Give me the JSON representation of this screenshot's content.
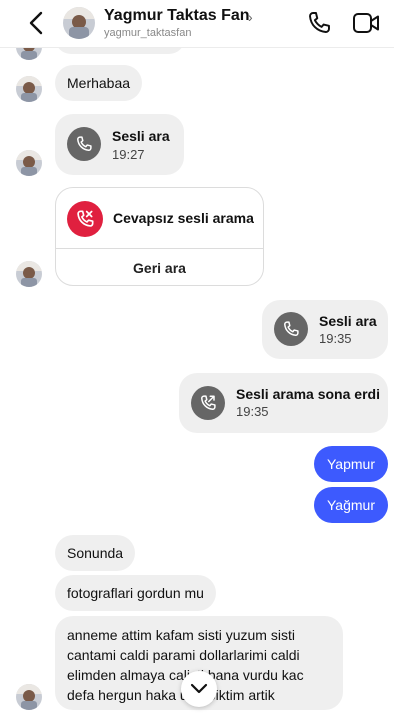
{
  "header": {
    "name": "Yagmur Taktas Fan",
    "chevron": "›",
    "username": "yagmur_taktasfan",
    "icons": {
      "back": "chevron-left-icon",
      "call": "phone-icon",
      "video": "video-camera-icon"
    }
  },
  "messages": {
    "m1": "Merhabaa",
    "call1": {
      "title": "Sesli ara",
      "time": "19:27"
    },
    "missed": {
      "title": "Cevapsız sesli arama",
      "action": "Geri ara"
    },
    "call2": {
      "title": "Sesli ara",
      "time": "19:35"
    },
    "call3": {
      "title": "Sesli arama sona erdi",
      "time": "19:35"
    },
    "mine1": "Yapmur",
    "mine2": "Yağmur",
    "m2": "Sonunda",
    "m3": "fotograflari gordun mu",
    "m4": {
      "line1": "anneme attim kafam sisti yuzum sisti",
      "line2": "cantami caldi parami dollarlarimi caldi",
      "line3": "elimden almaya calisti bana vurdu kac",
      "line4": "defa hergun haka     ufur biktim artik"
    }
  },
  "colors": {
    "accent": "#3d5afe",
    "missed": "#e0203f",
    "bubble": "#efefef",
    "callIcon": "#666666"
  }
}
